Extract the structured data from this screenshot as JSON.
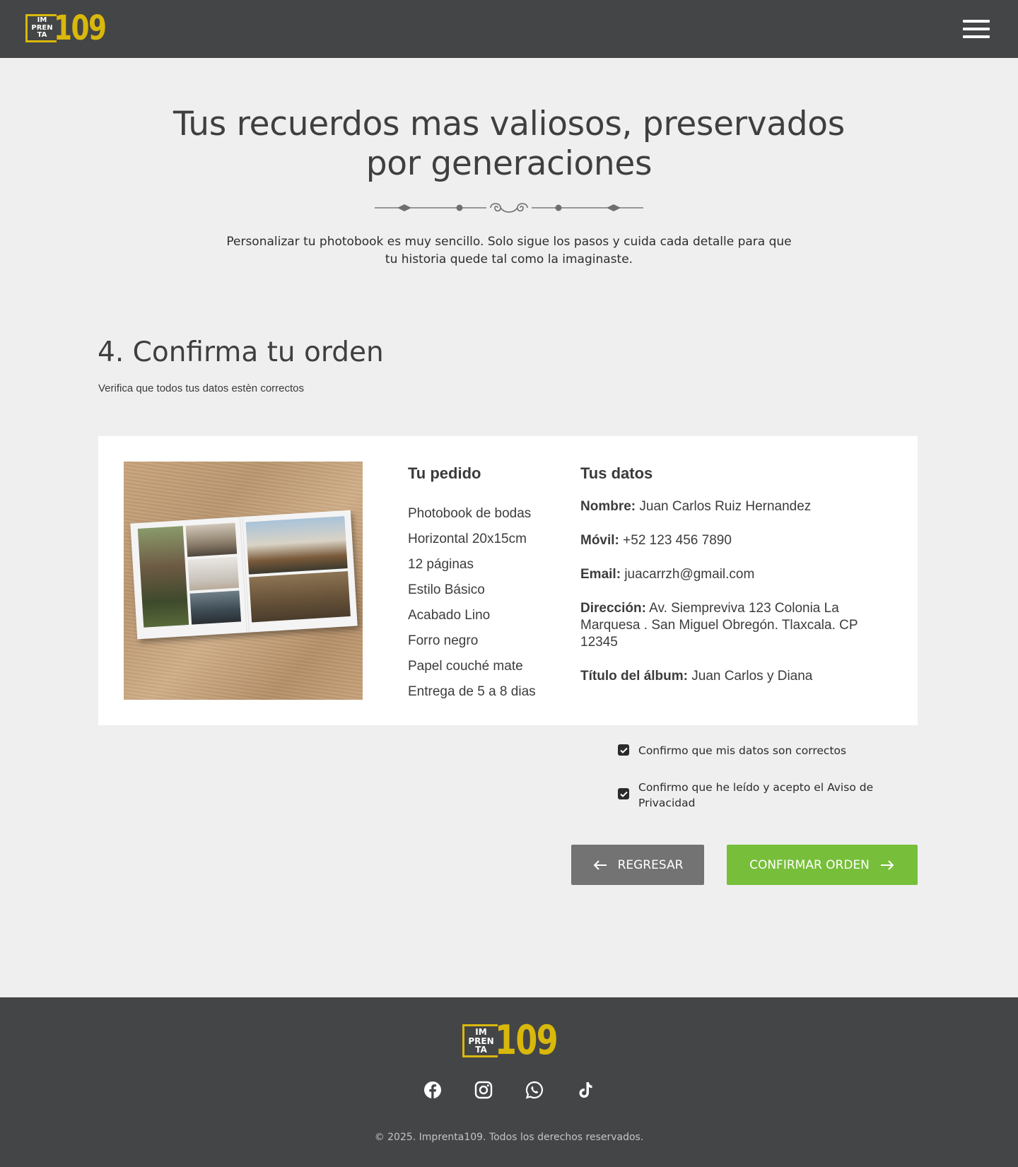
{
  "header": {
    "logo": {
      "box_lines": [
        "IM",
        "PREN",
        "TA"
      ],
      "number": "109"
    },
    "menu_icon": "hamburger-menu-icon"
  },
  "hero": {
    "title": "Tus recuerdos mas valiosos, preservados por generaciones",
    "subtitle": "Personalizar tu photobook es muy sencillo. Solo sigue los pasos y cuida cada detalle para que tu historia quede tal como la imaginaste."
  },
  "step": {
    "title": "4. Confirma tu orden",
    "subtitle": "Verifica que todos tus datos estèn correctos"
  },
  "order": {
    "title": "Tu pedido",
    "items": [
      "Photobook de bodas",
      "Horizontal 20x15cm",
      "12 páginas",
      "Estilo Básico",
      "Acabado Lino",
      "Forro negro",
      "Papel couché mate",
      "Entrega de 5 a 8 dias"
    ]
  },
  "customer": {
    "title": "Tus datos",
    "fields": [
      {
        "label": "Nombre:",
        "value": "Juan Carlos Ruiz Hernandez"
      },
      {
        "label": "Móvil:",
        "value": "+52 123 456 7890"
      },
      {
        "label": "Email:",
        "value": "juacarrzh@gmail.com"
      },
      {
        "label": "Dirección:",
        "value": "Av. Siempreviva 123 Colonia La Marquesa . San Miguel Obregón. Tlaxcala. CP 12345"
      },
      {
        "label": "Título del álbum:",
        "value": "Juan Carlos y Diana"
      }
    ]
  },
  "confirmations": [
    {
      "label": "Confirmo que mis datos son correctos",
      "checked": true
    },
    {
      "label": "Confirmo que he leído y acepto el Aviso de Privacidad",
      "checked": true
    }
  ],
  "buttons": {
    "back": "REGRESAR",
    "confirm": "CONFIRMAR ORDEN"
  },
  "footer": {
    "logo": {
      "box_lines": [
        "IM",
        "PREN",
        "TA"
      ],
      "number": "109"
    },
    "socials": [
      "facebook-icon",
      "instagram-icon",
      "whatsapp-icon",
      "tiktok-icon"
    ],
    "copyright": "© 2025. Imprenta109. Todos los derechos reservados."
  },
  "colors": {
    "header_bg": "#444546",
    "page_bg": "#efefef",
    "brand_yellow": "#d9b80c",
    "confirm_green": "#77bf3a",
    "back_gray": "#737373"
  }
}
